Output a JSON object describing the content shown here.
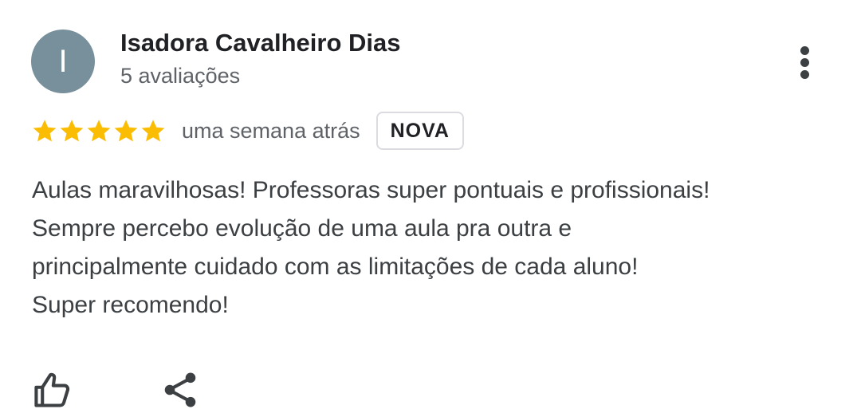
{
  "author": {
    "initial": "I",
    "name": "Isadora Cavalheiro Dias",
    "review_count": "5 avaliações",
    "avatar_color": "#78909c"
  },
  "review": {
    "rating": 5,
    "rating_max": 5,
    "star_color": "#fbbc04",
    "time_ago": "uma semana atrás",
    "badge": "NOVA",
    "text_lines": [
      "Aulas maravilhosas! Professoras super pontuais e profissionais!",
      "Sempre percebo evolução de uma aula pra outra e",
      "principalmente cuidado com as limitações de cada aluno!",
      "Super recomendo!"
    ]
  },
  "icons": {
    "more": "more-vert-icon",
    "like": "thumbs-up-icon",
    "share": "share-icon"
  }
}
